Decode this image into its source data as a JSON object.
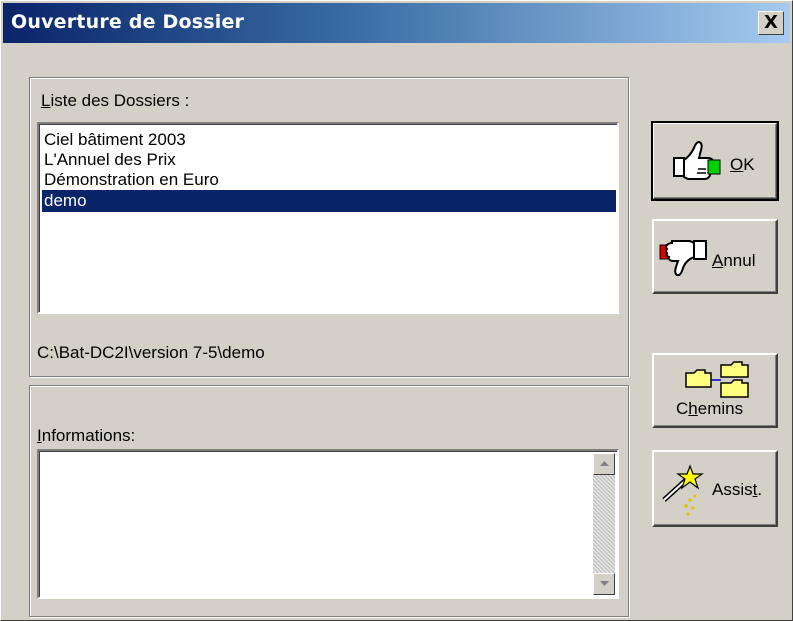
{
  "window": {
    "title": "Ouverture de Dossier",
    "close_glyph": "X"
  },
  "folders": {
    "label_first": "L",
    "label_rest": "iste des Dossiers :",
    "items": [
      {
        "label": "Ciel bâtiment 2003",
        "selected": false
      },
      {
        "label": "L'Annuel des Prix",
        "selected": false
      },
      {
        "label": "Démonstration en Euro",
        "selected": false
      },
      {
        "label": "demo",
        "selected": true
      }
    ],
    "path": "C:\\Bat-DC2I\\version 7-5\\demo"
  },
  "info": {
    "label_first": "I",
    "label_rest": "nformations:",
    "text": ""
  },
  "buttons": {
    "ok": {
      "pre": "",
      "accel": "O",
      "post": "K",
      "icon": "thumbs-up-icon"
    },
    "annul": {
      "pre": "",
      "accel": "A",
      "post": "nnul",
      "icon": "thumbs-down-icon"
    },
    "chemins": {
      "pre": "C",
      "accel": "h",
      "post": "emins",
      "icon": "folders-icon"
    },
    "assist": {
      "pre": "Assis",
      "accel": "t",
      "post": ".",
      "icon": "magic-wand-icon"
    }
  },
  "colors": {
    "title_start": "#0a246a",
    "title_end": "#a6caf0",
    "selection": "#0a246a",
    "face": "#d4d0c8"
  }
}
